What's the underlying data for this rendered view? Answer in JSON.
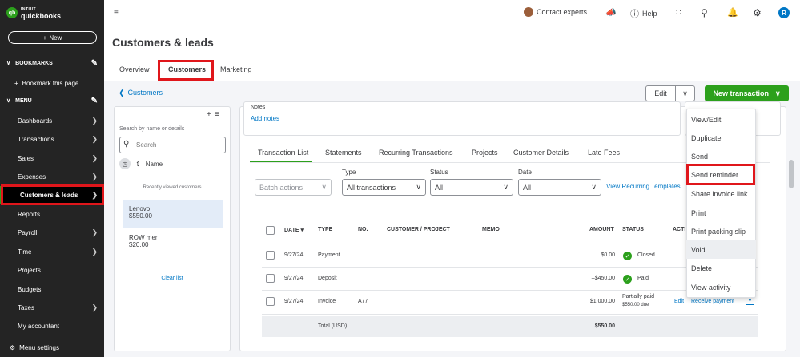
{
  "sidebar": {
    "logo_top": "INTUIT",
    "logo_bottom": "quickbooks",
    "new_label": "New",
    "bookmarks_label": "BOOKMARKS",
    "bookmark_this_page": "Bookmark this page",
    "menu_label": "MENU",
    "items": [
      {
        "label": "Dashboards"
      },
      {
        "label": "Transactions"
      },
      {
        "label": "Sales"
      },
      {
        "label": "Expenses"
      },
      {
        "label": "Customers & leads"
      },
      {
        "label": "Reports"
      },
      {
        "label": "Payroll"
      },
      {
        "label": "Time"
      },
      {
        "label": "Projects"
      },
      {
        "label": "Budgets"
      },
      {
        "label": "Taxes"
      },
      {
        "label": "My accountant"
      }
    ],
    "menu_settings": "Menu settings"
  },
  "topbar": {
    "contact_experts": "Contact experts",
    "help": "Help",
    "avatar_initial": "R"
  },
  "page": {
    "title": "Customers & leads",
    "tabs": [
      {
        "label": "Overview"
      },
      {
        "label": "Customers"
      },
      {
        "label": "Marketing"
      }
    ],
    "back_link": "Customers",
    "edit_label": "Edit",
    "new_transaction": "New transaction"
  },
  "customer_panel": {
    "search_label": "Search by name or details",
    "search_placeholder": "Search",
    "sort_label": "Name",
    "recent_label": "Recently viewed customers",
    "customers": [
      {
        "name": "Lenovo",
        "amount": "$550.00"
      },
      {
        "name": "ROW mer",
        "amount": "$20.00"
      }
    ],
    "clear_list": "Clear list"
  },
  "notes": {
    "label": "Notes",
    "add": "Add notes"
  },
  "subtabs": [
    {
      "label": "Transaction List"
    },
    {
      "label": "Statements"
    },
    {
      "label": "Recurring Transactions"
    },
    {
      "label": "Projects"
    },
    {
      "label": "Customer Details"
    },
    {
      "label": "Late Fees"
    }
  ],
  "filters": {
    "batch_actions": "Batch actions",
    "type_label": "Type",
    "type_value": "All transactions",
    "status_label": "Status",
    "status_value": "All",
    "date_label": "Date",
    "date_value": "All",
    "view_recurring": "View Recurring Templates"
  },
  "table": {
    "headers": {
      "date": "DATE",
      "type": "TYPE",
      "no": "NO.",
      "customer_project": "CUSTOMER / PROJECT",
      "memo": "MEMO",
      "amount": "AMOUNT",
      "status": "STATUS",
      "action": "ACTI"
    },
    "rows": [
      {
        "date": "9/27/24",
        "type": "Payment",
        "no": "",
        "amount": "$0.00",
        "status": "Closed"
      },
      {
        "date": "9/27/24",
        "type": "Deposit",
        "no": "",
        "amount": "–$450.00",
        "status": "Paid"
      },
      {
        "date": "9/27/24",
        "type": "Invoice",
        "no": "A77",
        "amount": "$1,000.00",
        "status_line1": "Partially paid",
        "status_line2": "$550.00 due",
        "action_edit": "Edit",
        "action_receive": "Receive payment"
      }
    ],
    "total_label": "Total (USD)",
    "total_amount": "$550.00"
  },
  "context_menu": {
    "items": [
      {
        "label": "View/Edit"
      },
      {
        "label": "Duplicate"
      },
      {
        "label": "Send"
      },
      {
        "label": "Send reminder"
      },
      {
        "label": "Share invoice link"
      },
      {
        "label": "Print"
      },
      {
        "label": "Print packing slip"
      },
      {
        "label": "Void"
      },
      {
        "label": "Delete"
      },
      {
        "label": "View activity"
      }
    ]
  },
  "colors": {
    "brand_green": "#2ca01c",
    "link_blue": "#0077c5",
    "highlight_red": "#e0161b",
    "sidebar_bg": "#242424"
  }
}
